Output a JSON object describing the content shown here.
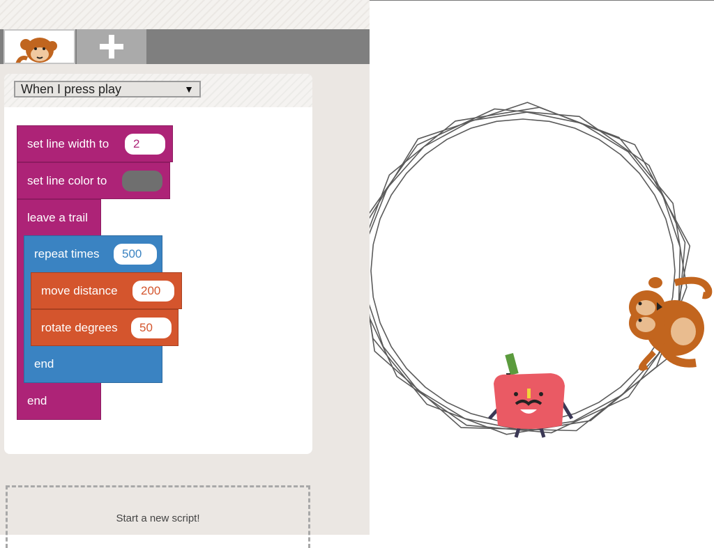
{
  "trigger": {
    "selected": "When I press play"
  },
  "blocks": {
    "line_width": {
      "label": "set line width to",
      "value": "2"
    },
    "line_color": {
      "label": "set line color to",
      "value_color": "#6f6f6f"
    },
    "trail": {
      "label": "leave a trail"
    },
    "repeat": {
      "label": "repeat times",
      "value": "500"
    },
    "move": {
      "label": "move distance",
      "value": "200"
    },
    "rotate": {
      "label": "rotate degrees",
      "value": "50"
    },
    "repeat_end": {
      "label": "end"
    },
    "outer_end": {
      "label": "end"
    }
  },
  "new_script": {
    "label": "Start a new script!"
  },
  "colors": {
    "pink": "#ad2377",
    "blue": "#3a83c2",
    "orange": "#d4552d",
    "trail": "#5a5a5a"
  },
  "sprites": [
    "monkey",
    "monster"
  ]
}
